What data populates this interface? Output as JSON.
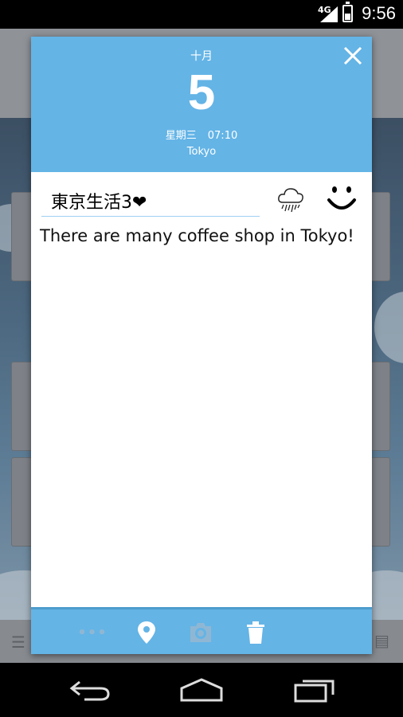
{
  "status_bar": {
    "network": "4G",
    "time": "9:56",
    "battery_level": 0.45,
    "icons": [
      "signal-icon",
      "battery-icon"
    ]
  },
  "dialog": {
    "header": {
      "month": "十月",
      "day": "5",
      "weekday": "星期三",
      "time": "07:10",
      "location": "Tokyo",
      "close_icon": "close-icon"
    },
    "title": "東京生活3❤",
    "weather_icon": "rain-cloud-icon",
    "mood_icon": "smiley-icon",
    "body": "There are many coffee shop in Tokyo!",
    "footer": {
      "more_label": "•••",
      "icons": [
        "more-icon",
        "location-pin-icon",
        "camera-icon",
        "trash-icon"
      ]
    }
  },
  "colors": {
    "accent": "#64b4e6",
    "accent_dark": "#4d9ccd",
    "field_underline": "#9fd0f0"
  },
  "nav_bar": {
    "icons": [
      "back-icon",
      "home-icon",
      "recents-icon"
    ]
  }
}
